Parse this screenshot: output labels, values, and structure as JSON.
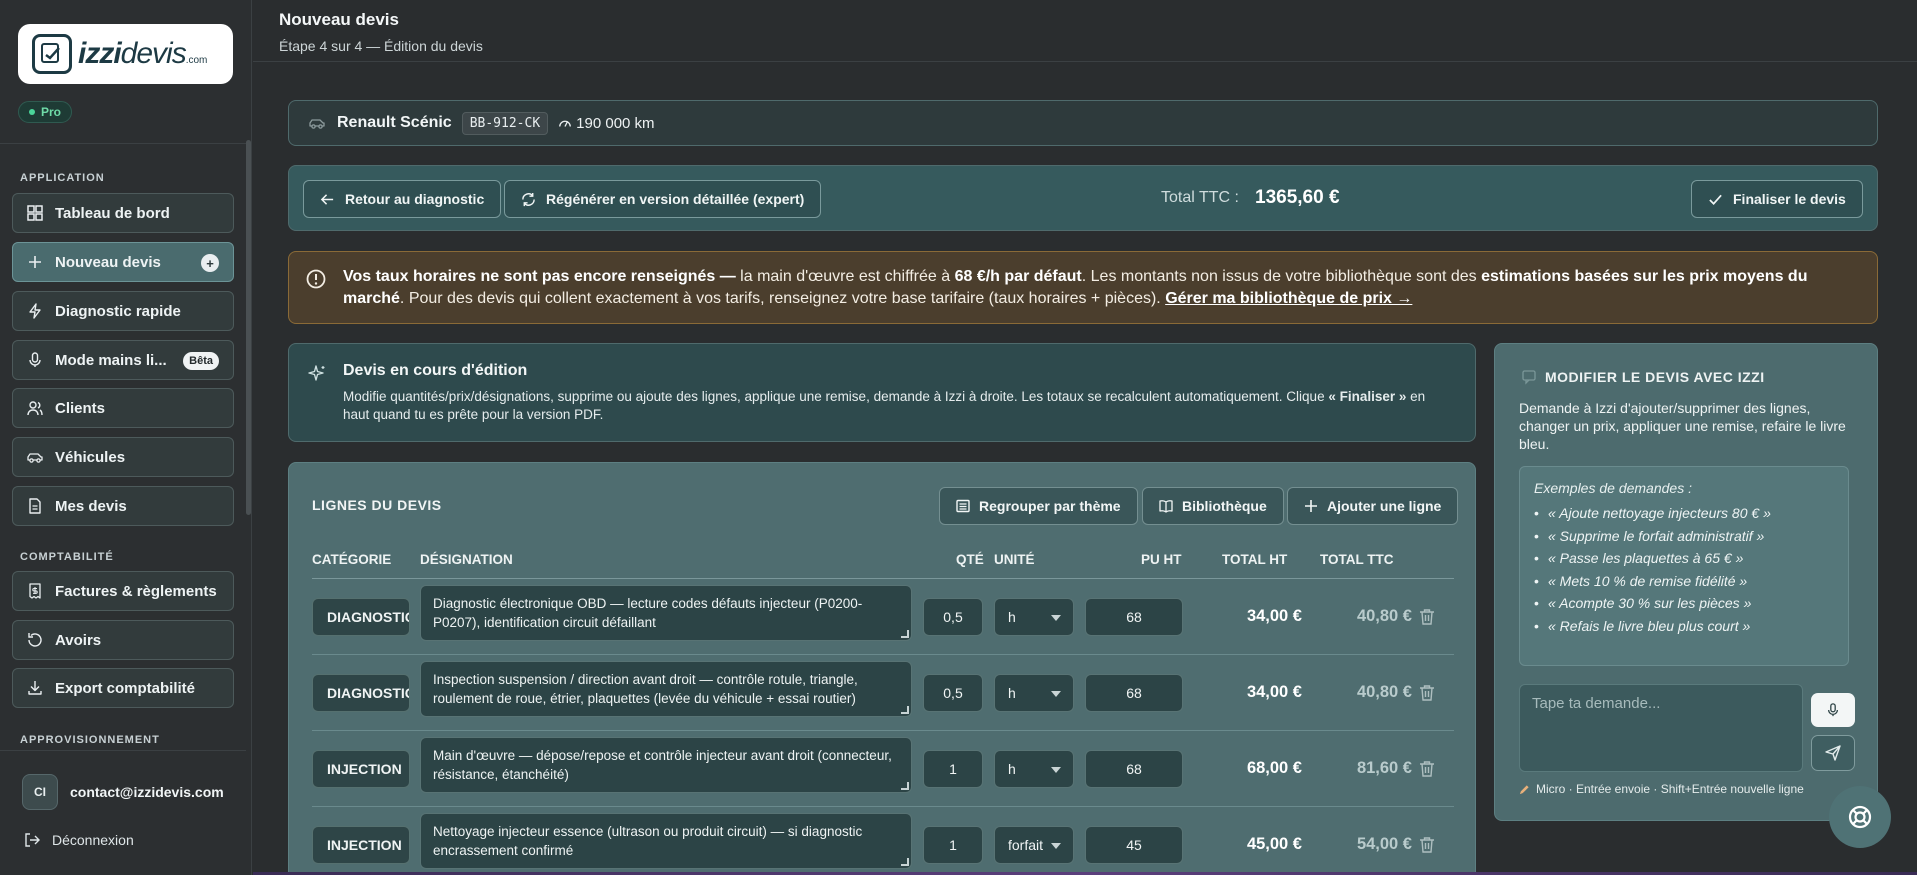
{
  "sidebar": {
    "logo": {
      "brand": "izzidevis",
      "brand_bold": "izzi",
      "brand_light": "devis",
      "domain": ".com"
    },
    "plan_badge": "Pro",
    "sections": {
      "application": "APPLICATION",
      "comptabilite": "COMPTABILITÉ",
      "approvisionnement": "APPROVISIONNEMENT"
    },
    "items": {
      "dashboard": "Tableau de bord",
      "new_quote": "Nouveau devis",
      "quick_diag": "Diagnostic rapide",
      "hands_free": "Mode mains li...",
      "hands_free_badge": "Bêta",
      "clients": "Clients",
      "vehicles": "Véhicules",
      "my_quotes": "Mes devis",
      "invoices": "Factures & règlements",
      "credits": "Avoirs",
      "export": "Export comptabilité"
    },
    "user": {
      "initials": "CI",
      "email": "contact@izzidevis.com"
    },
    "logout": "Déconnexion"
  },
  "header": {
    "title": "Nouveau devis",
    "subtitle": "Étape 4 sur 4 — Édition du devis"
  },
  "vehicle": {
    "name": "Renault Scénic",
    "plate": "BB-912-CK",
    "mileage": "190 000 km"
  },
  "actions": {
    "back": "Retour au diagnostic",
    "regenerate": "Régénérer en version détaillée (expert)",
    "total_label": "Total TTC :",
    "total_value": "1365,60 €",
    "finalize": "Finaliser le devis"
  },
  "warning": {
    "bold1": "Vos taux horaires ne sont pas encore renseignés —",
    "text1": " la main d'œuvre est chiffrée à ",
    "bold2": "68 €/h par défaut",
    "text2": ". Les montants non issus de votre bibliothèque sont des ",
    "bold3": "estimations basées sur les prix moyens du marché",
    "text3": ". Pour des devis qui collent exactement à vos tarifs, renseignez votre base tarifaire (taux horaires + pièces). ",
    "link": "Gérer ma bibliothèque de prix →"
  },
  "editing": {
    "title": "Devis en cours d'édition",
    "text": "Modifie quantités/prix/désignations, supprime ou ajoute des lignes, applique une remise, demande à Izzi à droite. Les totaux se recalculent automatiquement. Clique ",
    "bold": "« Finaliser »",
    "text_end": " en haut quand tu es prête pour la version PDF."
  },
  "lines": {
    "title": "LIGNES DU DEVIS",
    "btn_group": "Regrouper par thème",
    "btn_library": "Bibliothèque",
    "btn_add": "Ajouter une ligne",
    "headers": {
      "category": "CATÉGORIE",
      "designation": "DÉSIGNATION",
      "qty": "QTÉ",
      "unit": "UNITÉ",
      "pu": "PU HT",
      "total_ht": "TOTAL HT",
      "total_ttc": "TOTAL TTC"
    },
    "rows": [
      {
        "category": "DIAGNOSTIC",
        "designation": "Diagnostic électronique OBD — lecture codes défauts injecteur (P0200-P0207), identification circuit défaillant",
        "qty": "0,5",
        "unit": "h",
        "pu": "68",
        "total_ht": "34,00 €",
        "total_ttc": "40,80 €"
      },
      {
        "category": "DIAGNOSTIC",
        "designation": "Inspection suspension / direction avant droit — contrôle rotule, triangle, roulement de roue, étrier, plaquettes (levée du véhicule + essai routier)",
        "qty": "0,5",
        "unit": "h",
        "pu": "68",
        "total_ht": "34,00 €",
        "total_ttc": "40,80 €"
      },
      {
        "category": "INJECTION",
        "designation": "Main d'œuvre — dépose/repose et contrôle injecteur avant droit (connecteur, résistance, étanchéité)",
        "qty": "1",
        "unit": "h",
        "pu": "68",
        "total_ht": "68,00 €",
        "total_ttc": "81,60 €"
      },
      {
        "category": "INJECTION",
        "designation": "Nettoyage injecteur essence (ultrason ou produit circuit) — si diagnostic encrassement confirmé",
        "qty": "1",
        "unit": "forfait",
        "pu": "45",
        "total_ht": "45,00 €",
        "total_ttc": "54,00 €"
      }
    ]
  },
  "izzi": {
    "title": "MODIFIER LE DEVIS AVEC IZZI",
    "description": "Demande à Izzi d'ajouter/supprimer des lignes, changer un prix, appliquer une remise, refaire le livre bleu.",
    "examples_title": "Exemples de demandes :",
    "examples": [
      "« Ajoute nettoyage injecteurs 80 € »",
      "« Supprime le forfait administratif »",
      "« Passe les plaquettes à 65 € »",
      "« Mets 10 % de remise fidélité »",
      "« Acompte 30 % sur les pièces »",
      "« Refais le livre bleu plus court »"
    ],
    "input_placeholder": "Tape ta demande...",
    "hint": "Micro · Entrée envoie · Shift+Entrée nouvelle ligne"
  }
}
